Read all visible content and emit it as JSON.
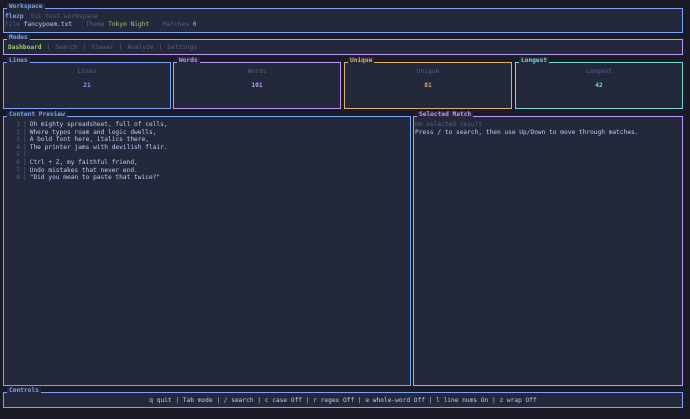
{
  "workspace": {
    "title": "Workspace",
    "app_name": "flezp",
    "subtitle": "tui text workspace",
    "file_label": "File",
    "file_value": "fancypoem.txt",
    "theme_label": "Theme",
    "theme_value": "Tokyo Night",
    "matches_label": "Matches",
    "matches_value": "0"
  },
  "modes": {
    "title": "Modes",
    "tabs": [
      {
        "label": "Dashboard",
        "active": true
      },
      {
        "label": "Search",
        "active": false
      },
      {
        "label": "Viewer",
        "active": false
      },
      {
        "label": "Analyze",
        "active": false
      },
      {
        "label": "Settings",
        "active": false
      }
    ],
    "separator": "|"
  },
  "stats": {
    "lines": {
      "title": "Lines",
      "label": "Lines",
      "value": "21"
    },
    "words": {
      "title": "Words",
      "label": "Words",
      "value": "101"
    },
    "unique": {
      "title": "Unique",
      "label": "Unique",
      "value": "81"
    },
    "longest": {
      "title": "Longest",
      "label": "Longest",
      "value": "42"
    }
  },
  "preview": {
    "title": "Content Preview",
    "separator": "|",
    "lines": [
      {
        "num": "1",
        "text": "Oh mighty spreadsheet, full of cells,"
      },
      {
        "num": "2",
        "text": "Where typos roam and logic dwells,"
      },
      {
        "num": "3",
        "text": "A bold font here, italics there,"
      },
      {
        "num": "4",
        "text": "The printer jams with devilish flair."
      },
      {
        "num": "5",
        "text": ""
      },
      {
        "num": "6",
        "text": "Ctrl + Z, my faithful friend,"
      },
      {
        "num": "7",
        "text": "Undo mistakes that never end."
      },
      {
        "num": "8",
        "text": "\"Did you mean to paste that twice?\""
      }
    ]
  },
  "match": {
    "title": "Selected Match",
    "status": "No selected result",
    "hint": "Press / to search, then use Up/Down to move through matches."
  },
  "controls": {
    "title": "Controls",
    "text": "q quit | Tab mode | / search | c case Off | r regex Off | e whole-word Off | l line nums On | z wrap Off"
  },
  "colors": {
    "background": "#1a1b26",
    "panel": "#24283b",
    "blue": "#7aa2f7",
    "purple": "#bb9af7",
    "orange": "#e0af68",
    "teal": "#73daca",
    "green": "#9ece6a",
    "text": "#c0caf5",
    "muted": "#565f89"
  }
}
